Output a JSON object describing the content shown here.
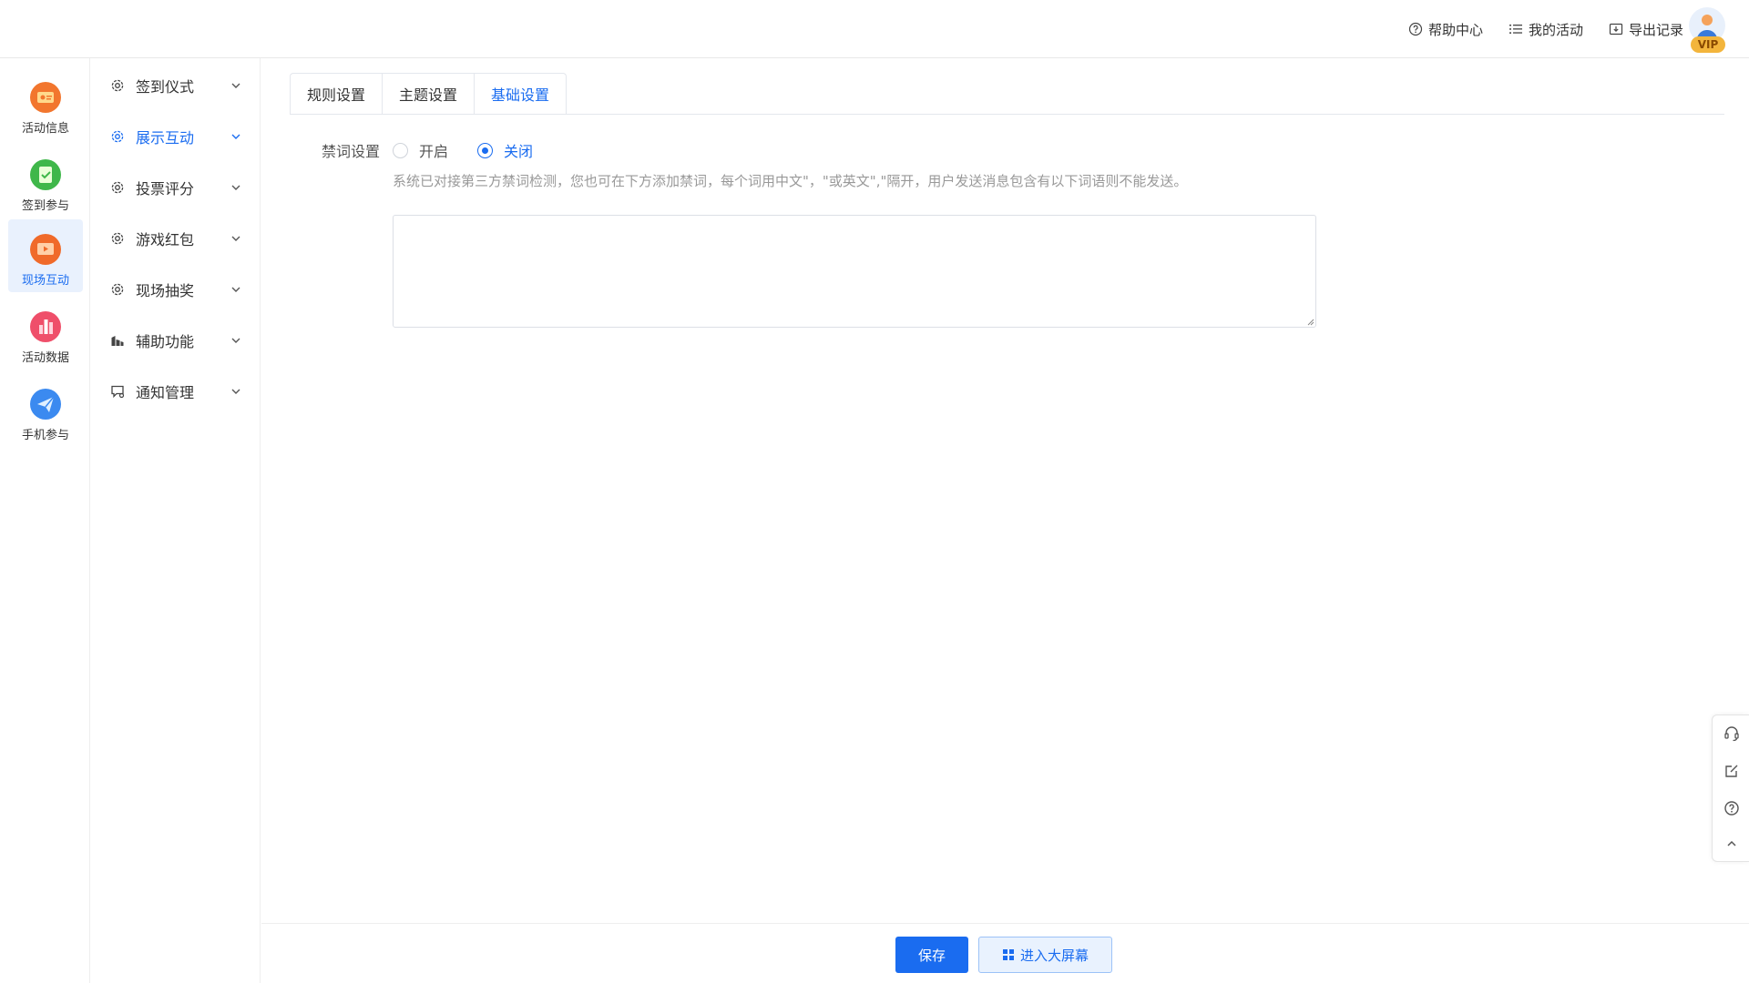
{
  "header": {
    "links": [
      {
        "label": "帮助中心",
        "icon": "help-circle-icon"
      },
      {
        "label": "我的活动",
        "icon": "list-icon"
      },
      {
        "label": "导出记录",
        "icon": "export-icon"
      }
    ],
    "avatar_badge": "VIP"
  },
  "rail": {
    "items": [
      {
        "label": "活动信息",
        "icon": "activity-info-icon",
        "color": "#f2762e"
      },
      {
        "label": "签到参与",
        "icon": "checkin-icon",
        "color": "#3fb74a"
      },
      {
        "label": "现场互动",
        "icon": "live-interaction-icon",
        "color": "#f06a2a",
        "active": true
      },
      {
        "label": "活动数据",
        "icon": "activity-data-icon",
        "color": "#ef4f6a"
      },
      {
        "label": "手机参与",
        "icon": "mobile-join-icon",
        "color": "#3b8af0"
      }
    ]
  },
  "submenu": {
    "items": [
      {
        "label": "签到仪式",
        "icon": "gear-icon"
      },
      {
        "label": "展示互动",
        "icon": "gear-icon",
        "active": true
      },
      {
        "label": "投票评分",
        "icon": "gear-icon"
      },
      {
        "label": "游戏红包",
        "icon": "gear-icon"
      },
      {
        "label": "现场抽奖",
        "icon": "gear-icon"
      },
      {
        "label": "辅助功能",
        "icon": "building-icon"
      },
      {
        "label": "通知管理",
        "icon": "notice-icon"
      }
    ]
  },
  "main": {
    "tabs": [
      {
        "label": "规则设置"
      },
      {
        "label": "主题设置"
      },
      {
        "label": "基础设置",
        "active": true
      }
    ],
    "forbidden": {
      "label": "禁词设置",
      "options": [
        {
          "label": "开启",
          "checked": false
        },
        {
          "label": "关闭",
          "checked": true
        }
      ],
      "hint": "系统已对接第三方禁词检测，您也可在下方添加禁词，每个词用中文\"，\"或英文\",\"隔开，用户发送消息包含有以下词语则不能发送。",
      "textarea_value": ""
    }
  },
  "footer": {
    "save_label": "保存",
    "big_screen_label": "进入大屏幕"
  },
  "float_bar": {
    "items": [
      "customer-service-icon",
      "edit-icon",
      "help-icon",
      "back-to-top-icon"
    ]
  },
  "colors": {
    "primary": "#1a6cf0",
    "active_bg": "#e9f1fd"
  }
}
